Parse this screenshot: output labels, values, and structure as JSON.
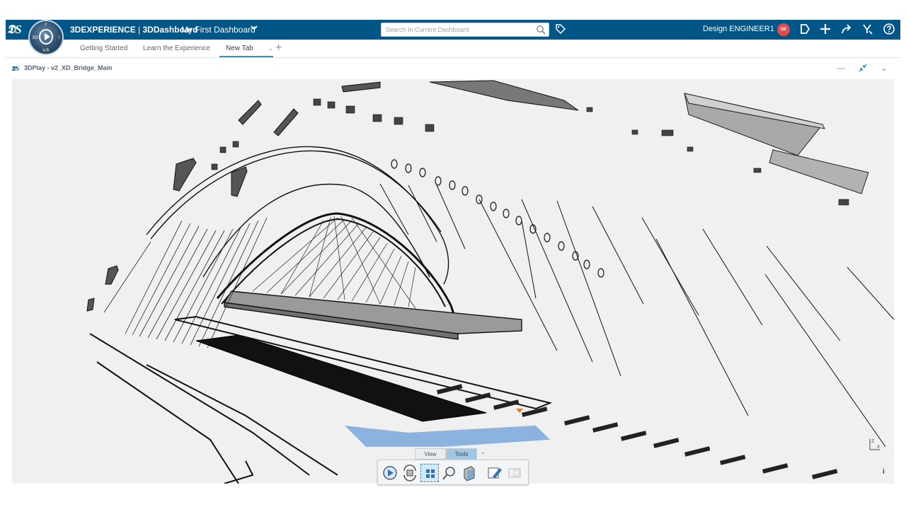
{
  "header": {
    "brand": "3DEXPERIENCE",
    "separator": " | ",
    "app": "3DDashboard",
    "dashboard_name": "My First Dashboard",
    "search_placeholder": "Search In Current Dashboard",
    "user_name": "Design ENGINEER1",
    "avatar_initials": "DE",
    "brand_color": "#005686",
    "avatar_color": "#e5484d",
    "compass_labels": {
      "top": "?",
      "left": "3D",
      "right": "i",
      "bottom": "V.R"
    }
  },
  "tabs": [
    {
      "label": "Getting Started"
    },
    {
      "label": "Learn the Experience"
    },
    {
      "label": "New Tab",
      "active": true
    }
  ],
  "widget": {
    "title": "3DPlay - v2_XD_Bridge_Main",
    "icon": "3ds-logo-icon"
  },
  "action_bar": {
    "tabs": [
      {
        "label": "View"
      },
      {
        "label": "Tools",
        "active": true
      }
    ],
    "buttons": [
      {
        "name": "play-icon"
      },
      {
        "name": "explode-icon"
      },
      {
        "name": "select-icon",
        "selected": true
      },
      {
        "name": "measure-icon"
      },
      {
        "name": "section-icon"
      },
      {
        "name": "annotate-icon"
      },
      {
        "name": "capture-icon"
      }
    ]
  },
  "viewer": {
    "triad_axes": [
      "Z",
      "X"
    ],
    "info_icon": "info-icon"
  }
}
